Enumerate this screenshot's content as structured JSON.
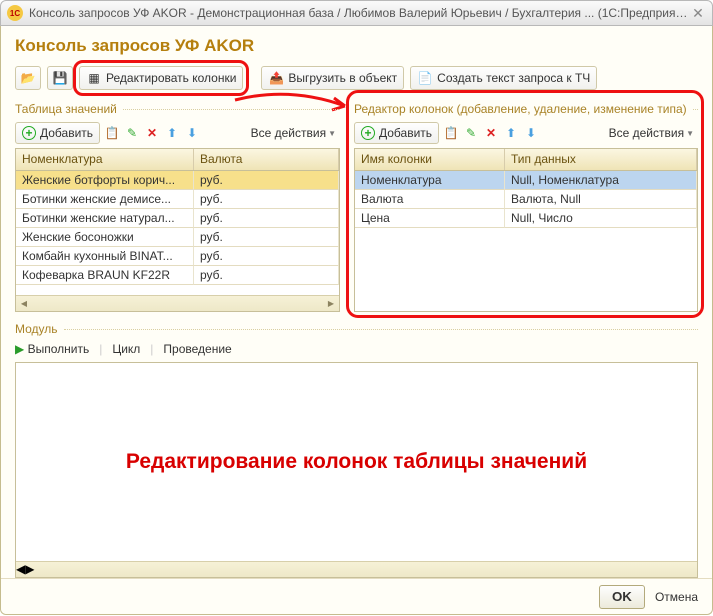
{
  "titlebar": {
    "app_icon": "1C",
    "title": "Консоль запросов УФ AKOR - Демонстрационная база / Любимов Валерий Юрьевич / Бухгалтерия ...  (1С:Предприятие)"
  },
  "app_title": "Консоль запросов УФ AKOR",
  "toolbar": {
    "edit_columns": "Редактировать колонки",
    "export_object": "Выгрузить в объект",
    "create_query_text": "Создать текст запроса к ТЧ"
  },
  "panel_left": {
    "header": "Таблица значений",
    "add": "Добавить",
    "all_actions": "Все действия",
    "columns": [
      "Номенклатура",
      "Валюта"
    ],
    "rows": [
      {
        "c1": "Женские ботфорты корич...",
        "c2": "руб.",
        "selected": true
      },
      {
        "c1": "Ботинки женские демисе...",
        "c2": "руб."
      },
      {
        "c1": "Ботинки женские натурал...",
        "c2": "руб."
      },
      {
        "c1": "Женские босоножки",
        "c2": "руб."
      },
      {
        "c1": "Комбайн кухонный BINAT...",
        "c2": "руб."
      },
      {
        "c1": "Кофеварка BRAUN KF22R",
        "c2": "руб."
      }
    ]
  },
  "panel_right": {
    "header": "Редактор колонок (добавление, удаление, изменение типа)",
    "add": "Добавить",
    "all_actions": "Все действия",
    "columns": [
      "Имя колонки",
      "Тип данных"
    ],
    "rows": [
      {
        "c1": "Номенклатура",
        "c2": "Null, Номенклатура",
        "selected": true
      },
      {
        "c1": "Валюта",
        "c2": "Валюта, Null"
      },
      {
        "c1": "Цена",
        "c2": "Null, Число"
      }
    ]
  },
  "module": {
    "header": "Модуль",
    "execute": "Выполнить",
    "cycle": "Цикл",
    "run_through": "Проведение"
  },
  "overlay_text": "Редактирование колонок таблицы значений",
  "footer": {
    "ok": "OK",
    "cancel": "Отмена"
  }
}
